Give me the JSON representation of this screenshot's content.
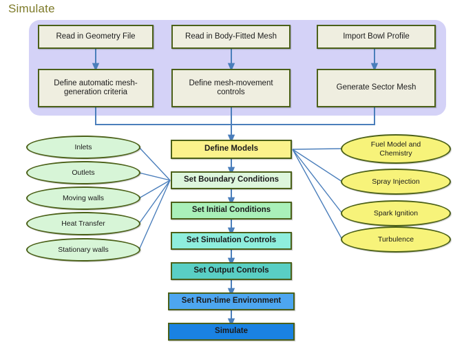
{
  "diagram": {
    "title": "Simulate",
    "title_color": "#7d7a28",
    "accent_wire_color": "#4a7ebb",
    "node_border_color": "#4b6018",
    "panel_color": "#d4d2f7"
  },
  "setup_panel": {
    "columns": [
      {
        "top": "Read in Geometry File",
        "bottom": "Define automatic mesh-generation criteria"
      },
      {
        "top": "Read in Body-Fitted Mesh",
        "bottom": "Define mesh-movement controls"
      },
      {
        "top": "Import Bowl Profile",
        "bottom": "Generate Sector Mesh"
      }
    ]
  },
  "main_flow": [
    {
      "label": "Define Models",
      "color": "#fbf28c"
    },
    {
      "label": "Set Boundary Conditions",
      "color": "#ddf6dd"
    },
    {
      "label": "Set Initial Conditions",
      "color": "#a9f0b9"
    },
    {
      "label": "Set Simulation Controls",
      "color": "#8eeedd"
    },
    {
      "label": "Set Output Controls",
      "color": "#59cfc4"
    },
    {
      "label": "Set Run-time Environment",
      "color": "#4da6f0"
    },
    {
      "label": "Simulate",
      "color": "#1a82e2"
    }
  ],
  "boundary_inputs": {
    "target": "Set Boundary Conditions",
    "items": [
      {
        "label": "Inlets"
      },
      {
        "label": "Outlets"
      },
      {
        "label": "Moving walls"
      },
      {
        "label": "Heat Transfer"
      },
      {
        "label": "Stationary walls"
      }
    ]
  },
  "model_inputs": {
    "target": "Define Models",
    "items": [
      {
        "label": "Fuel Model and Chemistry"
      },
      {
        "label": "Spray Injection"
      },
      {
        "label": "Spark Ignition"
      },
      {
        "label": "Turbulence"
      }
    ]
  }
}
